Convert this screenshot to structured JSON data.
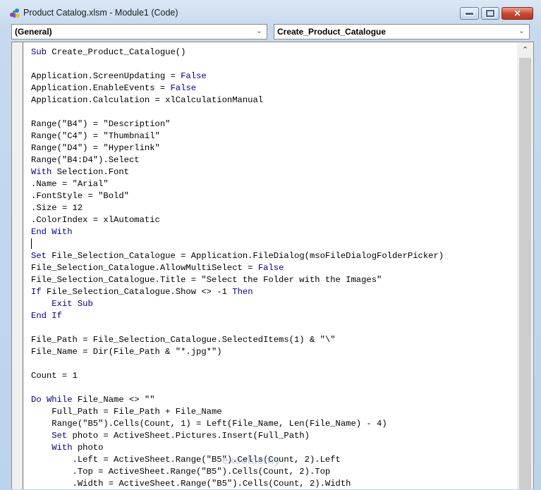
{
  "window": {
    "title": "Product Catalog.xlsm - Module1 (Code)",
    "icon": "vba-project-icon",
    "controls": {
      "minimize": "minimize-icon",
      "maximize": "maximize-icon",
      "close": "close-icon",
      "close_glyph": "✕"
    }
  },
  "object_combo": {
    "value": "(General)",
    "arrow": "⌄"
  },
  "procedure_combo": {
    "value": "Create_Product_Catalogue",
    "arrow": "⌄"
  },
  "scrollbar": {
    "up_arrow": "⌃"
  },
  "watermark": "exceldemy",
  "code": [
    [
      {
        "k": "kw",
        "t": "Sub"
      },
      {
        "t": " Create_Product_Catalogue()"
      }
    ],
    [],
    [
      {
        "t": "Application.ScreenUpdating = "
      },
      {
        "k": "kw",
        "t": "False"
      }
    ],
    [
      {
        "t": "Application.EnableEvents = "
      },
      {
        "k": "kw",
        "t": "False"
      }
    ],
    [
      {
        "t": "Application.Calculation = xlCalculationManual"
      }
    ],
    [],
    [
      {
        "t": "Range(\"B4\") = \"Description\""
      }
    ],
    [
      {
        "t": "Range(\"C4\") = \"Thumbnail\""
      }
    ],
    [
      {
        "t": "Range(\"D4\") = \"Hyperlink\""
      }
    ],
    [
      {
        "t": "Range(\"B4:D4\").Select"
      }
    ],
    [
      {
        "k": "kw",
        "t": "With"
      },
      {
        "t": " Selection.Font"
      }
    ],
    [
      {
        "t": ".Name = \"Arial\""
      }
    ],
    [
      {
        "t": ".FontStyle = \"Bold\""
      }
    ],
    [
      {
        "t": ".Size = 12"
      }
    ],
    [
      {
        "t": ".ColorIndex = xlAutomatic"
      }
    ],
    [
      {
        "k": "kw",
        "t": "End With"
      }
    ],
    [
      {
        "k": "caret",
        "t": ""
      }
    ],
    [
      {
        "k": "kw",
        "t": "Set"
      },
      {
        "t": " File_Selection_Catalogue = Application.FileDialog(msoFileDialogFolderPicker)"
      }
    ],
    [
      {
        "t": "File_Selection_Catalogue.AllowMultiSelect = "
      },
      {
        "k": "kw",
        "t": "False"
      }
    ],
    [
      {
        "t": "File_Selection_Catalogue.Title = \"Select the Folder with the Images\""
      }
    ],
    [
      {
        "k": "kw",
        "t": "If"
      },
      {
        "t": " File_Selection_Catalogue.Show <> -1 "
      },
      {
        "k": "kw",
        "t": "Then"
      }
    ],
    [
      {
        "t": "    "
      },
      {
        "k": "kw",
        "t": "Exit Sub"
      }
    ],
    [
      {
        "k": "kw",
        "t": "End If"
      }
    ],
    [],
    [
      {
        "t": "File_Path = File_Selection_Catalogue.SelectedItems(1) & \"\\\""
      }
    ],
    [
      {
        "t": "File_Name = Dir(File_Path & \"*.jpg*\")"
      }
    ],
    [],
    [
      {
        "t": "Count = 1"
      }
    ],
    [],
    [
      {
        "k": "kw",
        "t": "Do While"
      },
      {
        "t": " File_Name <> \"\""
      }
    ],
    [
      {
        "t": "    Full_Path = File_Path + File_Name"
      }
    ],
    [
      {
        "t": "    Range(\"B5\").Cells(Count, 1) = Left(File_Name, Len(File_Name) - 4)"
      }
    ],
    [
      {
        "t": "    "
      },
      {
        "k": "kw",
        "t": "Set"
      },
      {
        "t": " photo = ActiveSheet.Pictures.Insert(Full_Path)"
      }
    ],
    [
      {
        "t": "    "
      },
      {
        "k": "kw",
        "t": "With"
      },
      {
        "t": " photo"
      }
    ],
    [
      {
        "t": "        .Left = ActiveSheet.Range(\"B5\").Cells(Count, 2).Left"
      }
    ],
    [
      {
        "t": "        .Top = ActiveSheet.Range(\"B5\").Cells(Count, 2).Top"
      }
    ],
    [
      {
        "t": "        .Width = ActiveSheet.Range(\"B5\").Cells(Count, 2).Width"
      }
    ]
  ]
}
